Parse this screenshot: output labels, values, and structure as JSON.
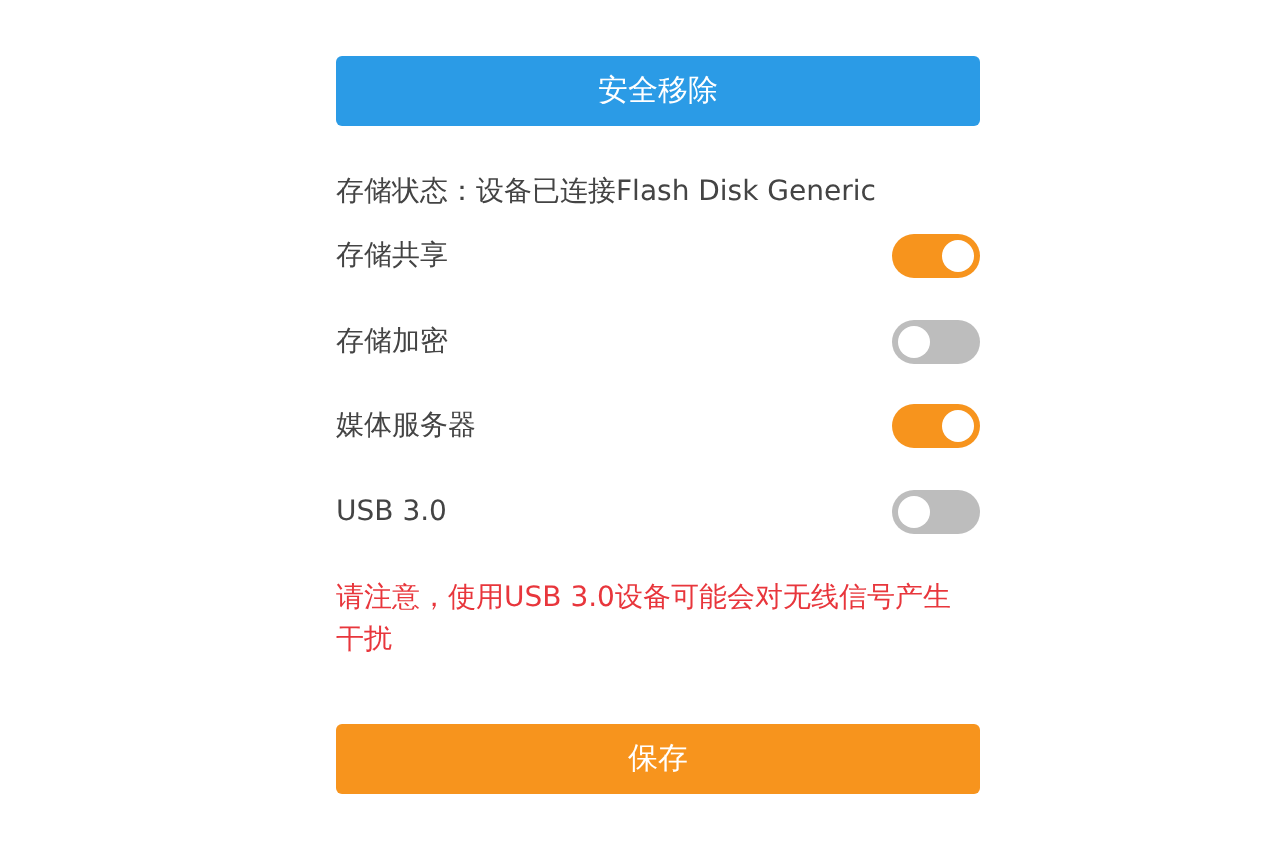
{
  "remove_button": {
    "label": "安全移除"
  },
  "storage_status": "存储状态：设备已连接Flash Disk Generic",
  "settings": [
    {
      "label": "存储共享",
      "on": true
    },
    {
      "label": "存储加密",
      "on": false
    },
    {
      "label": "媒体服务器",
      "on": true
    },
    {
      "label": "USB 3.0",
      "on": false
    }
  ],
  "warning": "请注意，使用USB 3.0设备可能会对无线信号产生干扰",
  "save_button": {
    "label": "保存"
  }
}
